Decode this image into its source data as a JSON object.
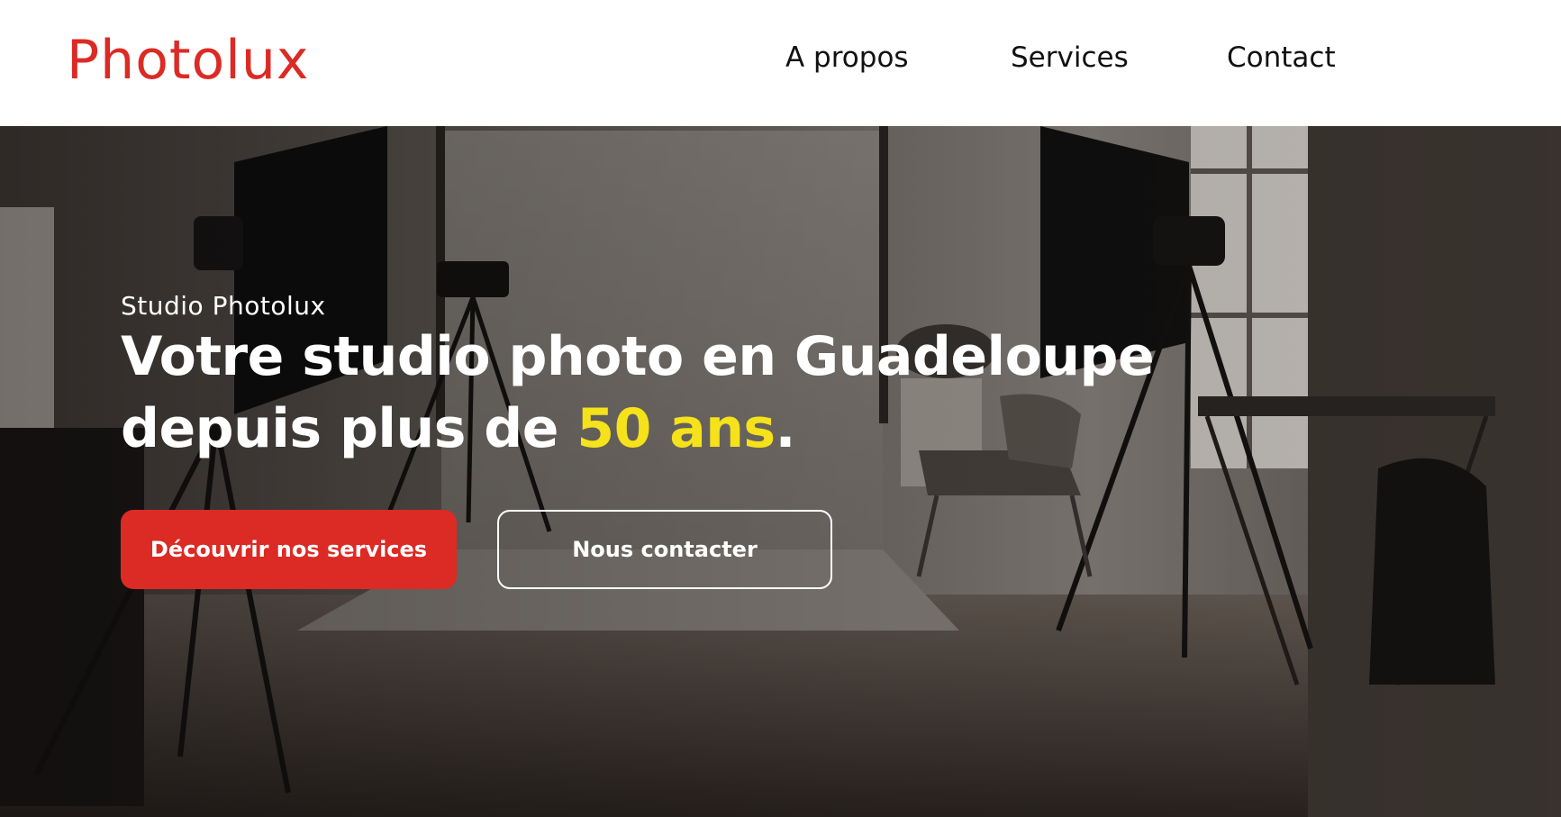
{
  "brand": {
    "logo": "Photolux",
    "color": "#dc2a25"
  },
  "nav": {
    "items": [
      {
        "label": "A propos"
      },
      {
        "label": "Services"
      },
      {
        "label": "Contact"
      }
    ]
  },
  "hero": {
    "eyebrow": "Studio Photolux",
    "title_line1": "Votre studio photo en Guadeloupe",
    "title_line2_prefix": "depuis plus de ",
    "title_highlight": "50 ans",
    "title_suffix": ".",
    "highlight_color": "#f5e21a",
    "primary_button": "Découvrir nos services",
    "secondary_button": "Nous contacter",
    "background": "photo-studio-image"
  }
}
